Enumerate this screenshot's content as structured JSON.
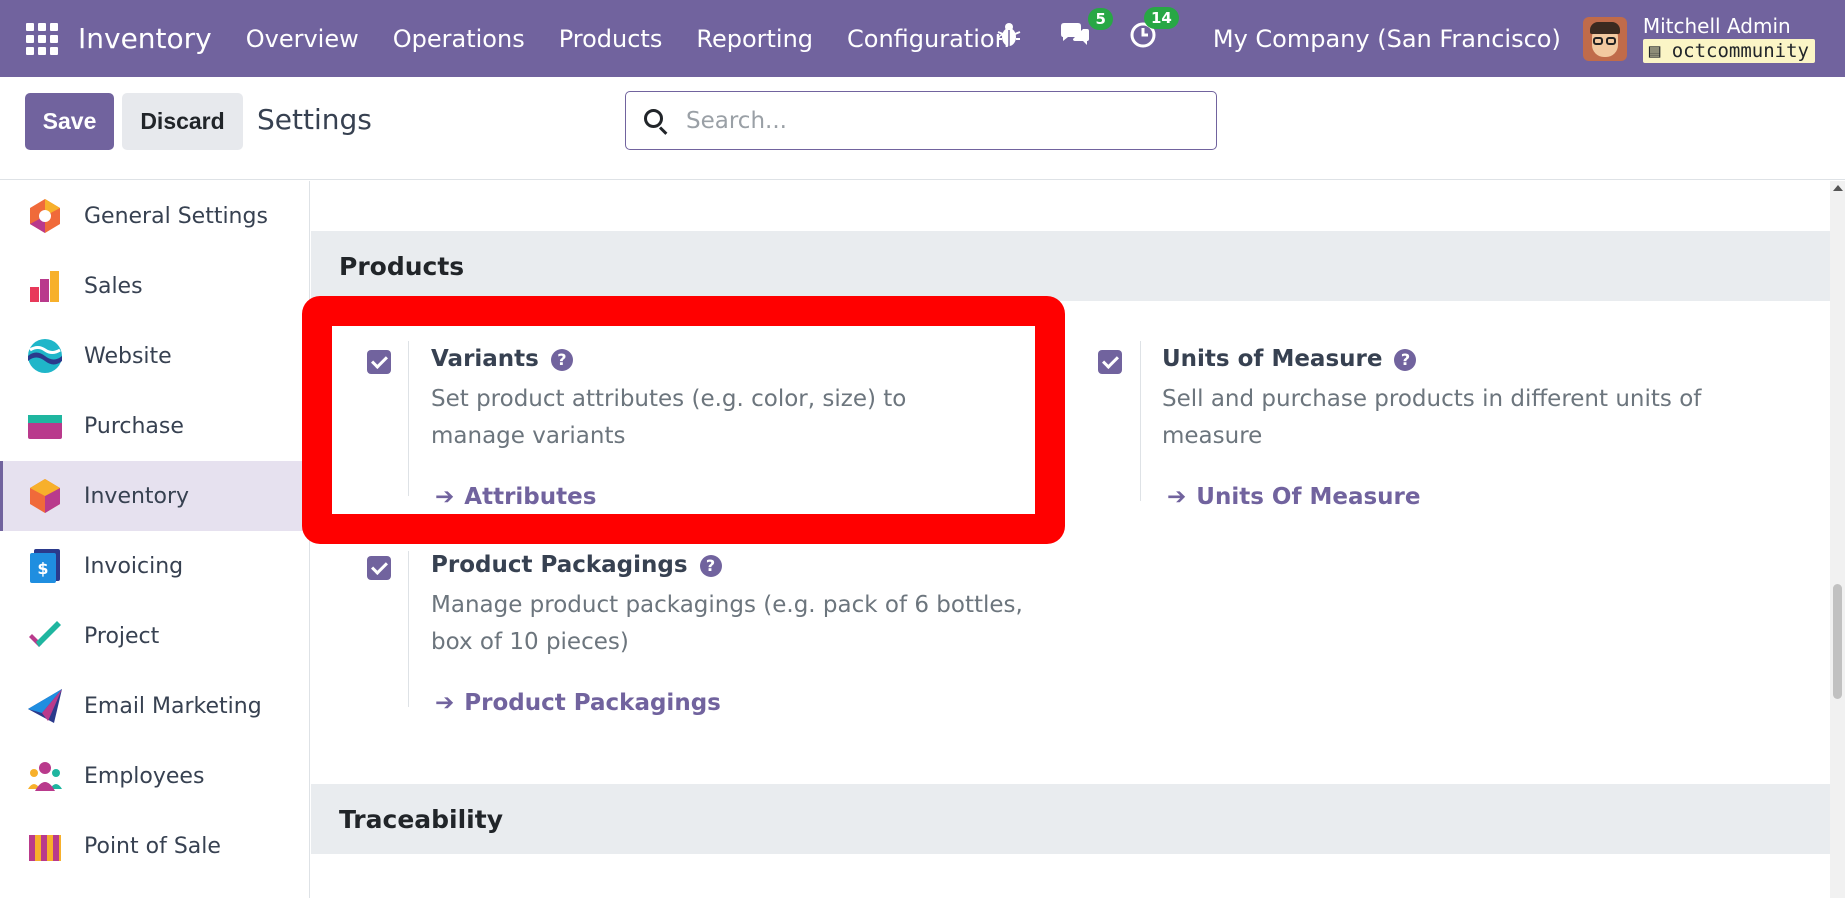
{
  "navbar": {
    "brand": "Inventory",
    "menu": [
      "Overview",
      "Operations",
      "Products",
      "Reporting",
      "Configuration"
    ],
    "chat_badge": "5",
    "activity_badge": "14",
    "company": "My Company (San Francisco)",
    "user_name": "Mitchell Admin",
    "db_name": "octcommunity",
    "color": "#71639e"
  },
  "control_panel": {
    "save_label": "Save",
    "discard_label": "Discard",
    "title": "Settings",
    "search_placeholder": "Search..."
  },
  "sidebar": {
    "items": [
      {
        "label": "General Settings",
        "icon": "general-settings-icon"
      },
      {
        "label": "Sales",
        "icon": "sales-icon"
      },
      {
        "label": "Website",
        "icon": "website-icon"
      },
      {
        "label": "Purchase",
        "icon": "purchase-icon"
      },
      {
        "label": "Inventory",
        "icon": "inventory-icon",
        "active": true
      },
      {
        "label": "Invoicing",
        "icon": "invoicing-icon"
      },
      {
        "label": "Project",
        "icon": "project-icon"
      },
      {
        "label": "Email Marketing",
        "icon": "email-marketing-icon"
      },
      {
        "label": "Employees",
        "icon": "employees-icon"
      },
      {
        "label": "Point of Sale",
        "icon": "point-of-sale-icon"
      }
    ]
  },
  "main": {
    "products_heading": "Products",
    "traceability_heading": "Traceability",
    "settings": {
      "variants": {
        "title": "Variants",
        "desc": "Set product attributes (e.g. color, size) to manage variants",
        "link": "Attributes",
        "checked": true
      },
      "uom": {
        "title": "Units of Measure",
        "desc": "Sell and purchase products in different units of measure",
        "link": "Units Of Measure",
        "checked": true
      },
      "packagings": {
        "title": "Product Packagings",
        "desc": "Manage product packagings (e.g. pack of 6 bottles, box of 10 pieces)",
        "link": "Product Packagings",
        "checked": true
      }
    },
    "help_glyph": "?",
    "arrow_glyph": "➔"
  },
  "highlight_color": "#ff0000"
}
